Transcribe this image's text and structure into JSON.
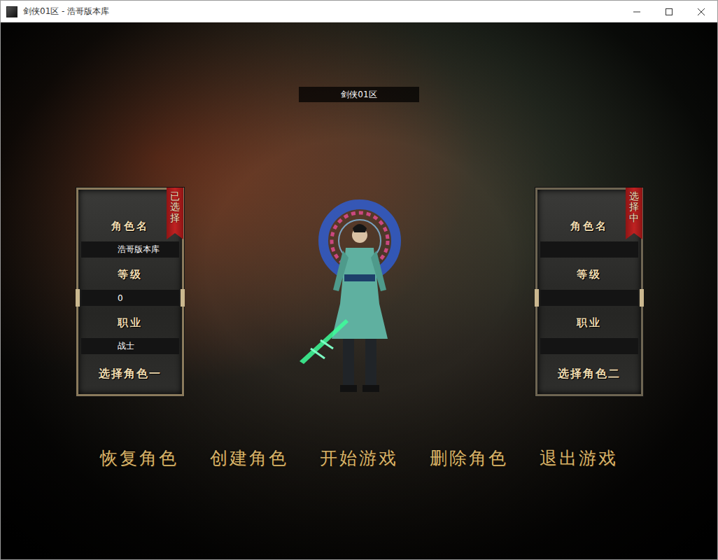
{
  "window": {
    "title": "剑侠01区 - 浩哥版本库"
  },
  "server": {
    "name": "剑侠01区"
  },
  "slots": [
    {
      "badge": "已选择",
      "selected": true,
      "button": "选择角色一",
      "fields": [
        {
          "label": "角色名",
          "value": "浩哥版本库",
          "kind": "text"
        },
        {
          "label": "等级",
          "value": "0",
          "kind": "level"
        },
        {
          "label": "职业",
          "value": "战士",
          "kind": "text"
        }
      ]
    },
    {
      "badge": "选择中",
      "selected": false,
      "button": "选择角色二",
      "fields": [
        {
          "label": "角色名",
          "value": "",
          "kind": "text"
        },
        {
          "label": "等级",
          "value": "",
          "kind": "level"
        },
        {
          "label": "职业",
          "value": "",
          "kind": "text"
        }
      ]
    }
  ],
  "actions": [
    "恢复角色",
    "创建角色",
    "开始游戏",
    "删除角色",
    "退出游戏"
  ]
}
